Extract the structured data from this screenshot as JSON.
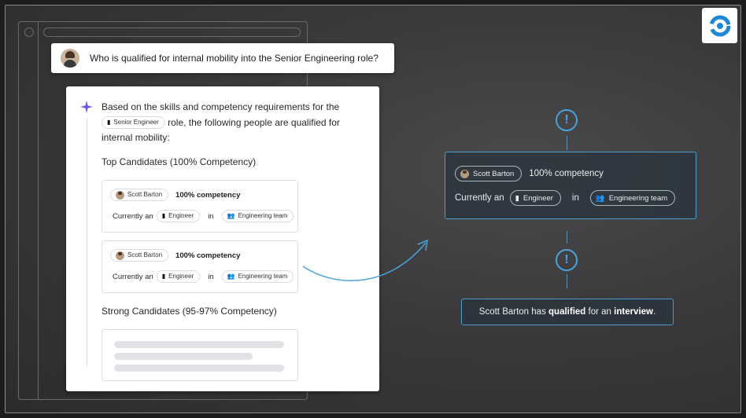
{
  "question": {
    "text": "Who is qualified for internal mobility into the Senior Engineering role?"
  },
  "answer": {
    "intro_before": "Based on the skills and competency requirements for the",
    "role_chip": "Senior Engineer",
    "intro_after": "role, the following people are qualified for internal mobility:",
    "top_title": "Top Candidates (100% Competency)",
    "strong_title": "Strong Candidates (95-97% Competency)",
    "candidates": [
      {
        "name": "Scott Barton",
        "competency": "100% competency",
        "currently": "Currently an",
        "role": "Engineer",
        "in": "in",
        "team": "Engineering team"
      },
      {
        "name": "Scott Barton",
        "competency": "100% competency",
        "currently": "Currently an",
        "role": "Engineer",
        "in": "in",
        "team": "Engineering team"
      }
    ]
  },
  "info_card": {
    "name": "Scott Barton",
    "competency": "100% competency",
    "currently": "Currently an",
    "role": "Engineer",
    "in": "in",
    "team": "Engineering team"
  },
  "result": {
    "prefix": "Scott Barton has",
    "qualified": "qualified",
    "middle": "for an",
    "interview": "interview",
    "suffix": "."
  },
  "alerts": [
    "!",
    "!"
  ],
  "colors": {
    "accent": "#4aa3dc",
    "sparkle": "#6b5ce7",
    "logo": "#1e88d6"
  },
  "icons": {
    "logo": "refresh-logo-icon",
    "sparkle": "sparkle-icon",
    "role": "badge-icon",
    "team": "people-icon",
    "alert": "exclamation-icon"
  }
}
